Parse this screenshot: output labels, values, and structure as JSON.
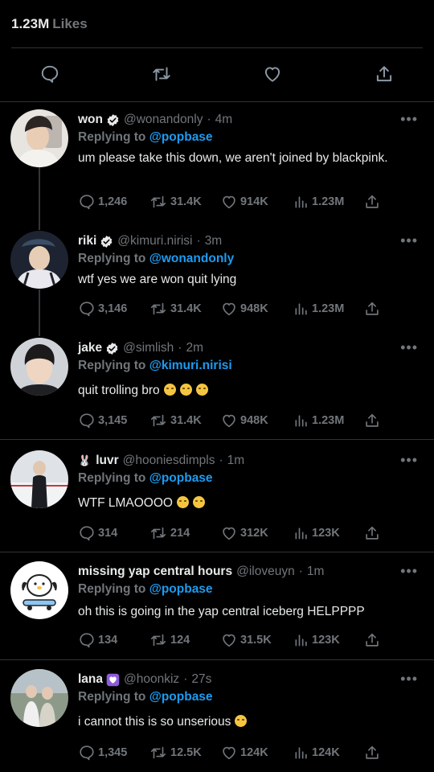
{
  "header": {
    "likes_count": "1.23M",
    "likes_label": "Likes"
  },
  "colors": {
    "background": "#000000",
    "text": "#e7e9ea",
    "muted": "#71767b",
    "link": "#1d9bf0",
    "border": "#2f3336"
  },
  "actions": [
    {
      "icon": "reply-icon"
    },
    {
      "icon": "retweet-icon"
    },
    {
      "icon": "like-icon"
    },
    {
      "icon": "share-icon"
    }
  ],
  "tweets": [
    {
      "name": "won",
      "badge": "verified",
      "handle": "@wonandonly",
      "time": "4m",
      "replying_label": "Replying to",
      "replying_to": "@popbase",
      "text": "um please take this down, we aren't joined by blackpink.",
      "emojis": 0,
      "replies": "1,246",
      "retweets": "31.4K",
      "likes": "914K",
      "views": "1.23M"
    },
    {
      "name": "riki",
      "badge": "verified",
      "handle": "@kimuri.nirisi",
      "time": "3m",
      "replying_label": "Replying to",
      "replying_to": "@wonandonly",
      "text": "wtf yes we are won quit lying",
      "emojis": 0,
      "replies": "3,146",
      "retweets": "31.4K",
      "likes": "948K",
      "views": "1.23M"
    },
    {
      "name": "jake",
      "badge": "verified",
      "handle": "@simlish",
      "time": "2m",
      "replying_label": "Replying to",
      "replying_to": "@kimuri.nirisi",
      "text": "quit trolling bro",
      "emojis": 3,
      "replies": "3,145",
      "retweets": "31.4K",
      "likes": "948K",
      "views": "1.23M"
    },
    {
      "name": "luvr",
      "badge": "none",
      "handle": "@hooniesdimpls",
      "time": "1m",
      "replying_label": "Replying to",
      "replying_to": "@popbase",
      "text": "WTF LMAOOOO",
      "emojis": 2,
      "replies": "314",
      "retweets": "214",
      "likes": "312K",
      "views": "123K"
    },
    {
      "name": "missing yap central hours",
      "badge": "none",
      "handle": "@iloveuyn",
      "time": "1m",
      "replying_label": "Replying to",
      "replying_to": "@popbase",
      "text": "oh this is going in the yap central iceberg HELPPPP",
      "emojis": 0,
      "replies": "134",
      "retweets": "124",
      "likes": "31.5K",
      "views": "123K"
    },
    {
      "name": "lana",
      "badge": "purple-heart",
      "handle": "@hoonkiz",
      "time": "27s",
      "replying_label": "Replying to",
      "replying_to": "@popbase",
      "text": "i cannot this is so unserious",
      "emojis": 1,
      "replies": "1,345",
      "retweets": "12.5K",
      "likes": "124K",
      "views": "124K"
    }
  ]
}
